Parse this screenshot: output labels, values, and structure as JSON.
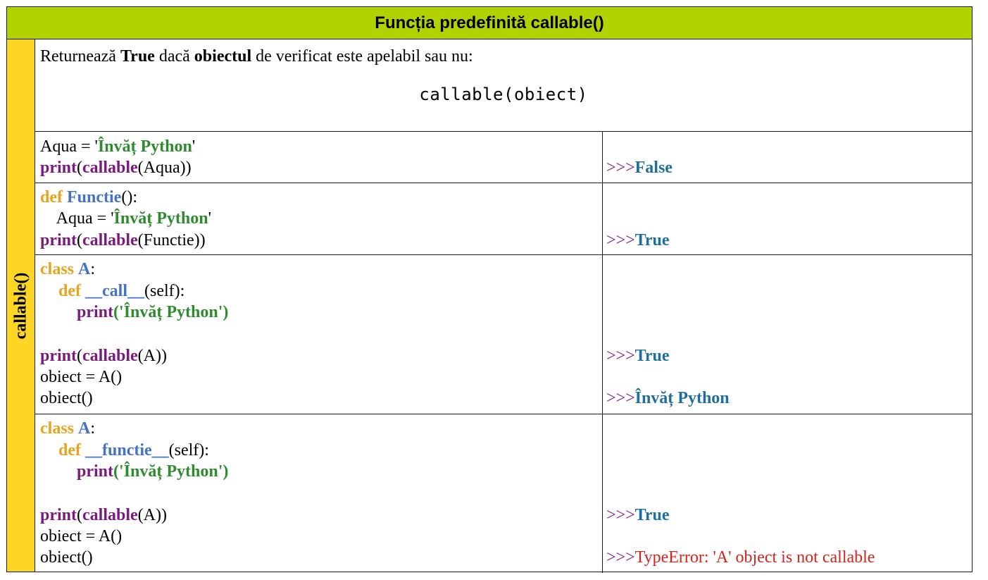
{
  "title": "Funcția predefinită callable()",
  "side_label": "callable()",
  "description": {
    "t1": "Returnează ",
    "b1": "True",
    "t2": " dacă ",
    "b2": "obiectul",
    "t3": " de verificat este apelabil sau nu:",
    "signature": "callable(obiect)"
  },
  "tokens": {
    "print": "print",
    "callable": "callable",
    "def": "def",
    "class": "class",
    "prompt": ">>>",
    "str_python": "Învăț Python"
  },
  "example1": {
    "var": "Aqua = '",
    "quote_end": "'",
    "call_arg": "(Aqua))",
    "result": "False"
  },
  "example2": {
    "name": "Functie",
    "sig_end": "():",
    "indent_var": "    Aqua = '",
    "quote_end": "'",
    "call_arg": "(Functie))",
    "result": "True"
  },
  "example3": {
    "class_name": "A",
    "colon": ":",
    "method": "__call__",
    "method_sig": "(self):",
    "print_open": "('",
    "print_close": "')",
    "call_arg": "(A))",
    "obj_create": "obiect = A()",
    "obj_call": "obiect()",
    "result1": "True",
    "result2": "Învăț Python"
  },
  "example4": {
    "class_name": "A",
    "colon": ":",
    "method": "__functie__",
    "method_sig": "(self):",
    "print_open": "('",
    "print_close": "')",
    "call_arg": "(A))",
    "obj_create": "obiect = A()",
    "obj_call": "obiect()",
    "result1": "True",
    "error": "TypeError: 'A' object is not callable"
  },
  "colors": {
    "header_bg": "#b2d200",
    "side_bg": "#fdd525",
    "keyword": "#e8a41c",
    "function_name": "#4472c4",
    "builtin": "#7b1a7e",
    "string": "#2e8b2e",
    "result": "#1f6e9c",
    "error": "#d9221c"
  }
}
